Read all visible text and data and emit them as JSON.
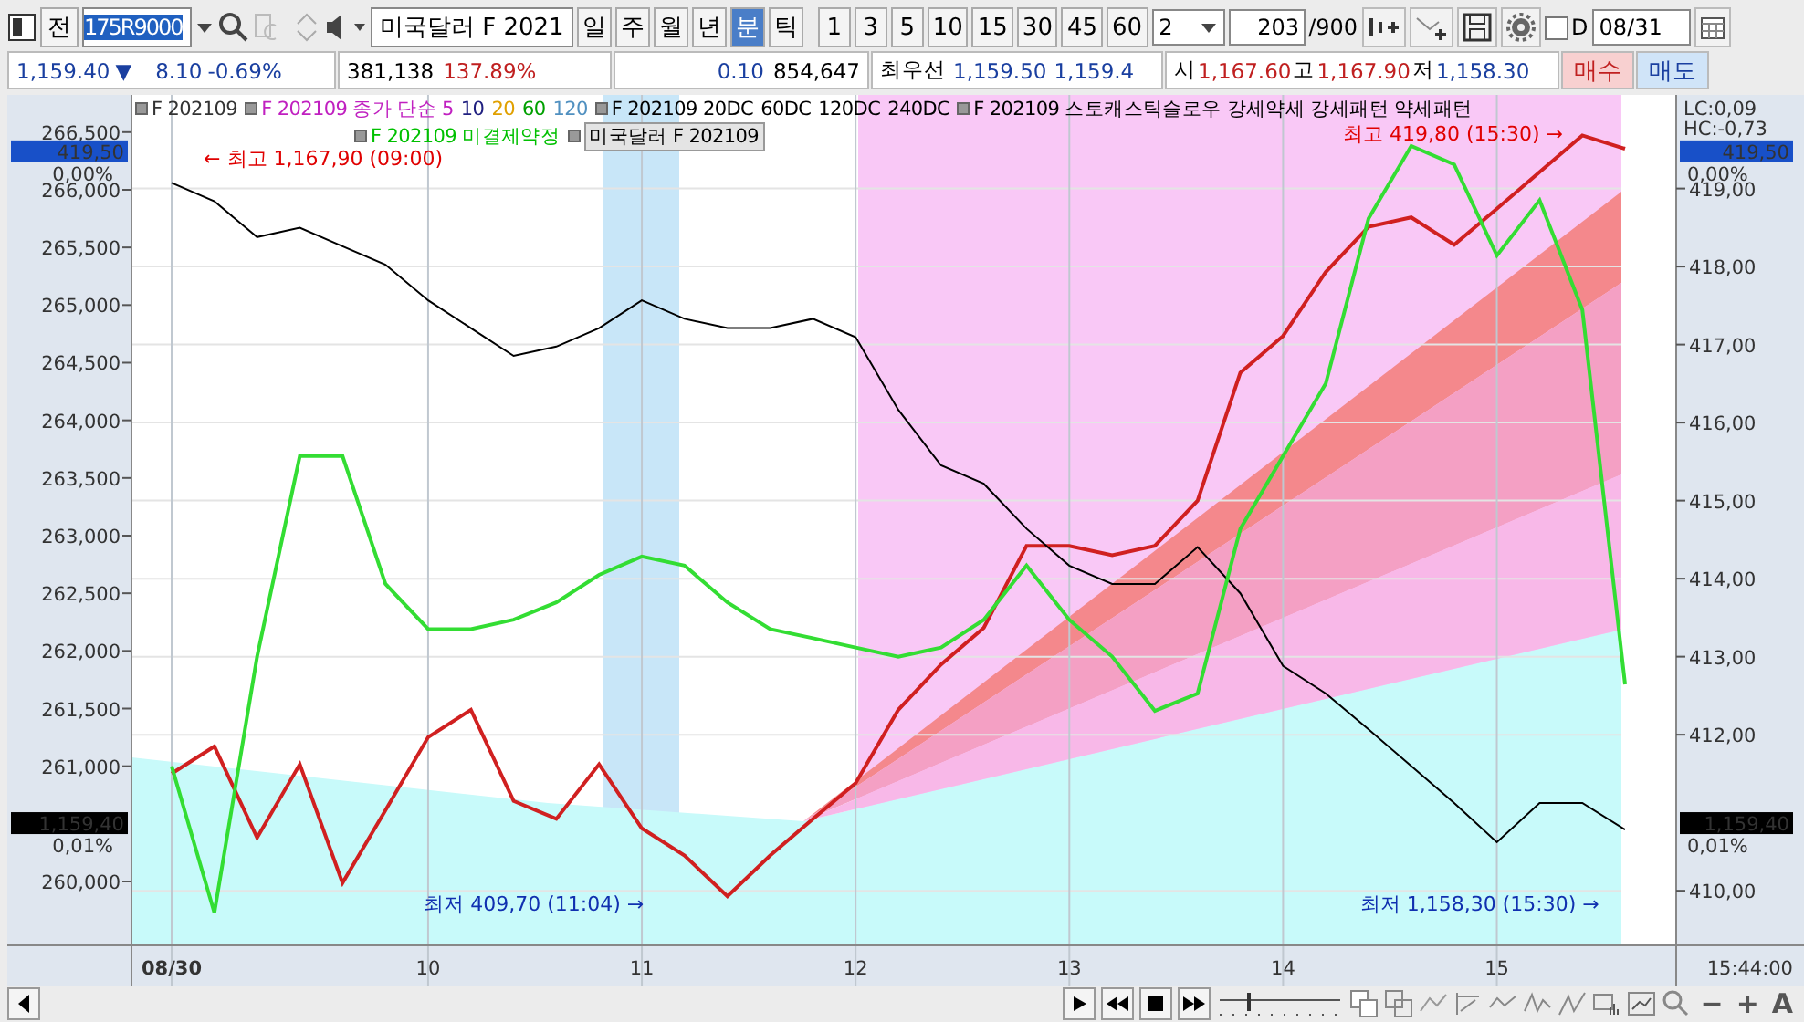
{
  "toolbar": {
    "prev_button": "전",
    "code": "175R9000",
    "name": "미국달러 F 2021",
    "periods": [
      {
        "label": "일",
        "selected": false
      },
      {
        "label": "주",
        "selected": false
      },
      {
        "label": "월",
        "selected": false
      },
      {
        "label": "년",
        "selected": false
      },
      {
        "label": "분",
        "selected": true
      },
      {
        "label": "틱",
        "selected": false
      }
    ],
    "intervals": [
      "1",
      "3",
      "5",
      "10",
      "15",
      "30",
      "45",
      "60"
    ],
    "multiplier": "2",
    "count": "203",
    "count_max": "/900",
    "d_checkbox": {
      "label": "D",
      "checked": false
    },
    "date": "08/31"
  },
  "quote": {
    "price": "1,159.40",
    "direction": "▼",
    "change": "8.10",
    "change_pct": "-0.69%",
    "volume": "381,138",
    "volume_pct": "137.89%",
    "tick": "0.10",
    "open_interest": "854,647",
    "best_label": "최우선",
    "best_ask": "1,159.50",
    "best_bid": "1,159.4",
    "open_label": "시",
    "open": "1,167.60",
    "high_label": "고",
    "high": "1,167.90",
    "low_label": "저",
    "low": "1,158.30",
    "buy_button": "매수",
    "sell_button": "매도"
  },
  "legend": {
    "row_1": [
      {
        "text": "F 202109",
        "color": "#333333",
        "marker": true
      },
      {
        "text": "F 202109 종가 단순 5",
        "color": "#c020c0",
        "marker": true
      },
      {
        "text": "10",
        "color": "#202080",
        "marker": false
      },
      {
        "text": "20",
        "color": "#e0a000",
        "marker": false
      },
      {
        "text": "60",
        "color": "#00a000",
        "marker": false
      },
      {
        "text": "120",
        "color": "#5090c0",
        "marker": false
      },
      {
        "text": "F 202109 20DC",
        "color": "#000000",
        "marker": true
      },
      {
        "text": "60DC",
        "color": "#000000",
        "marker": false
      },
      {
        "text": "120DC",
        "color": "#000000",
        "marker": false
      },
      {
        "text": "240DC",
        "color": "#000000",
        "marker": false
      },
      {
        "text": "F 202109 스토캐스틱슬로우 강세약세 강세패턴  약세패턴",
        "color": "#000000",
        "marker": true
      }
    ],
    "row_2": [
      {
        "text": "F 202109 미결제약정",
        "color": "#00c000",
        "kind": "plain"
      },
      {
        "text": "미국달러 F 202109",
        "color": "#000000",
        "kind": "boxed"
      }
    ]
  },
  "chart": {
    "lc": "LC:0,09",
    "hc": "HC:-0,73",
    "time_label": "15:44:00",
    "markers": [
      {
        "kind": "current",
        "label": "419,50",
        "percent": "0,00%"
      },
      {
        "kind": "current",
        "label": "419,50",
        "percent": "0,00%"
      },
      {
        "kind": "reference",
        "label": "1,159,40",
        "percent": "0,01%"
      },
      {
        "kind": "reference",
        "label": "1,159,40",
        "percent": "0,01%"
      }
    ],
    "chart_data": {
      "type": "line",
      "categories": [
        "08/30",
        null,
        null,
        null,
        null,
        null,
        "10",
        null,
        null,
        null,
        null,
        "11",
        null,
        null,
        null,
        null,
        "12",
        null,
        null,
        null,
        null,
        "13",
        null,
        null,
        null,
        null,
        "14",
        null,
        null,
        null,
        null,
        "15",
        null,
        null,
        null
      ],
      "ylim": [
        409.3,
        420.2
      ],
      "y2lim": [
        259446,
        266823
      ],
      "grid": true,
      "yticks": [
        {
          "value": 419,
          "label": "419,00"
        },
        {
          "value": 418,
          "label": "418,00"
        },
        {
          "value": 417,
          "label": "417,00"
        },
        {
          "value": 416,
          "label": "416,00"
        },
        {
          "value": 415,
          "label": "415,00"
        },
        {
          "value": 414,
          "label": "414,00"
        },
        {
          "value": 413,
          "label": "413,00"
        },
        {
          "value": 412,
          "label": "412,00"
        },
        {
          "value": 410,
          "label": "410,00"
        }
      ],
      "y2ticks": [
        {
          "value": 266500,
          "label": "266,500"
        },
        {
          "value": 266000,
          "label": "266,000"
        },
        {
          "value": 265500,
          "label": "265,500"
        },
        {
          "value": 265000,
          "label": "265,000"
        },
        {
          "value": 264500,
          "label": "264,500"
        },
        {
          "value": 264000,
          "label": "264,000"
        },
        {
          "value": 263500,
          "label": "263,500"
        },
        {
          "value": 263000,
          "label": "263,000"
        },
        {
          "value": 262500,
          "label": "262,500"
        },
        {
          "value": 262000,
          "label": "262,000"
        },
        {
          "value": 261500,
          "label": "261,500"
        },
        {
          "value": 261000,
          "label": "261,000"
        },
        {
          "value": 260000,
          "label": "260,000"
        }
      ],
      "series": [
        {
          "color": "#d02020",
          "values": [
            411.5,
            411.85,
            410.68,
            411.62,
            410.1,
            411.03,
            411.97,
            412.32,
            411.15,
            410.92,
            411.62,
            410.8,
            410.45,
            409.93,
            410.45,
            410.92,
            411.38,
            412.32,
            412.9,
            413.37,
            414.42,
            414.42,
            414.3,
            414.42,
            415.0,
            416.64,
            417.11,
            417.93,
            418.51,
            418.63,
            418.28,
            418.74,
            419.21,
            419.68,
            419.51
          ]
        },
        {
          "color": "#000000",
          "axis": "y2",
          "values": [
            266060,
            265900,
            265590,
            265670,
            265510,
            265350,
            265040,
            264800,
            264560,
            264640,
            264800,
            265040,
            264880,
            264800,
            264800,
            264880,
            264720,
            264090,
            263610,
            263450,
            263060,
            262740,
            262580,
            262580,
            262900,
            262500,
            261870,
            261630,
            261320,
            261000,
            260680,
            260340,
            260680,
            260680,
            260450
          ]
        },
        {
          "color": "#33dd33",
          "axis": "y2",
          "values": [
            261000,
            259730,
            261950,
            263690,
            263690,
            262580,
            262190,
            262190,
            262270,
            262420,
            262660,
            262820,
            262740,
            262420,
            262190,
            262110,
            262030,
            261950,
            262030,
            262270,
            262740,
            262270,
            261950,
            261480,
            261630,
            263060,
            263690,
            264320,
            265750,
            266380,
            266220,
            265430,
            265910,
            264960,
            261710
          ]
        }
      ],
      "annotations": [
        "← 최고 1,167,90 (09:00)",
        "최고 419,80 (15:30) →",
        "최저 409,70 (11:04) →",
        "최저 1,158,30 (15:30) →"
      ]
    }
  },
  "bottom_bar": {
    "zoom_out": "−",
    "zoom_in": "+",
    "font_button": "A"
  }
}
